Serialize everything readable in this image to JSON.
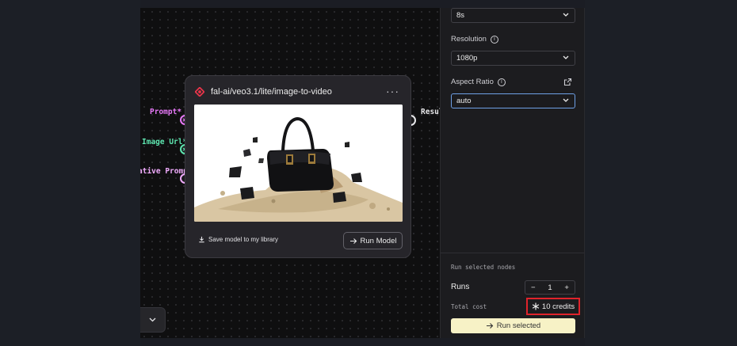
{
  "canvas": {
    "inputs": [
      {
        "label": "Prompt*",
        "color": "#e879f9"
      },
      {
        "label": "Image Url*",
        "color": "#5ee6b0"
      },
      {
        "label": "ative Prompt",
        "color": "#f0abfc"
      }
    ],
    "output": {
      "label": "Resul"
    },
    "node": {
      "title": "fal-ai/veo3.1/lite/image-to-video",
      "more_icon": "ellipsis-icon",
      "save_label": "Save model to my library",
      "run_label": "Run Model"
    }
  },
  "sidebar": {
    "duration": {
      "value": "8s"
    },
    "resolution": {
      "label": "Resolution",
      "value": "1080p"
    },
    "aspect_ratio": {
      "label": "Aspect Ratio",
      "value": "auto"
    },
    "run_section": {
      "title": "Run selected nodes",
      "runs_label": "Runs",
      "runs_value": "1",
      "total_label": "Total cost",
      "credits": "10 credits",
      "run_button": "Run selected"
    }
  },
  "colors": {
    "accent_yellow": "#f7f2c6",
    "highlight_red": "#e0232b",
    "focus_blue": "#6ea0e6",
    "brand_red": "#e8354a"
  }
}
